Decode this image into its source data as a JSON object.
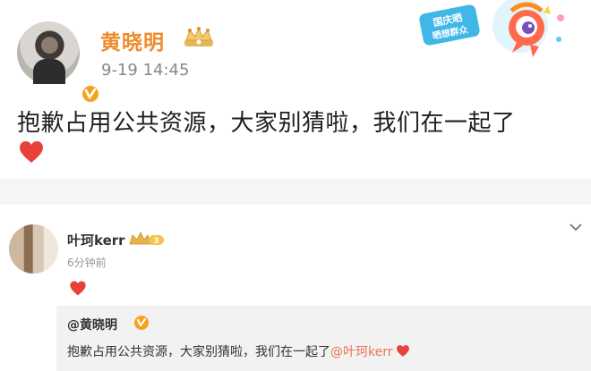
{
  "post": {
    "author": "黄晓明",
    "timestamp": "9-19 14:45",
    "text": "抱歉占用公共资源，大家别猜啦，我们在一起了",
    "event_badge_lines": [
      "国庆晒",
      "晒想群众"
    ]
  },
  "comment": {
    "author": "叶珂kerr",
    "level": "3",
    "time": "6分钟前",
    "quoted": {
      "author": "@黄晓明",
      "text": "抱歉占用公共资源，大家别猜啦，我们在一起了",
      "mention": "@叶珂kerr"
    }
  },
  "colors": {
    "author_orange": "#f08b2d",
    "heart_red": "#e8413a",
    "verified_gold": "#f7a21b",
    "mention_color": "#eb7350"
  },
  "icons": [
    "verified-icon",
    "crown-icon",
    "heart-icon",
    "chevron-down-icon"
  ]
}
